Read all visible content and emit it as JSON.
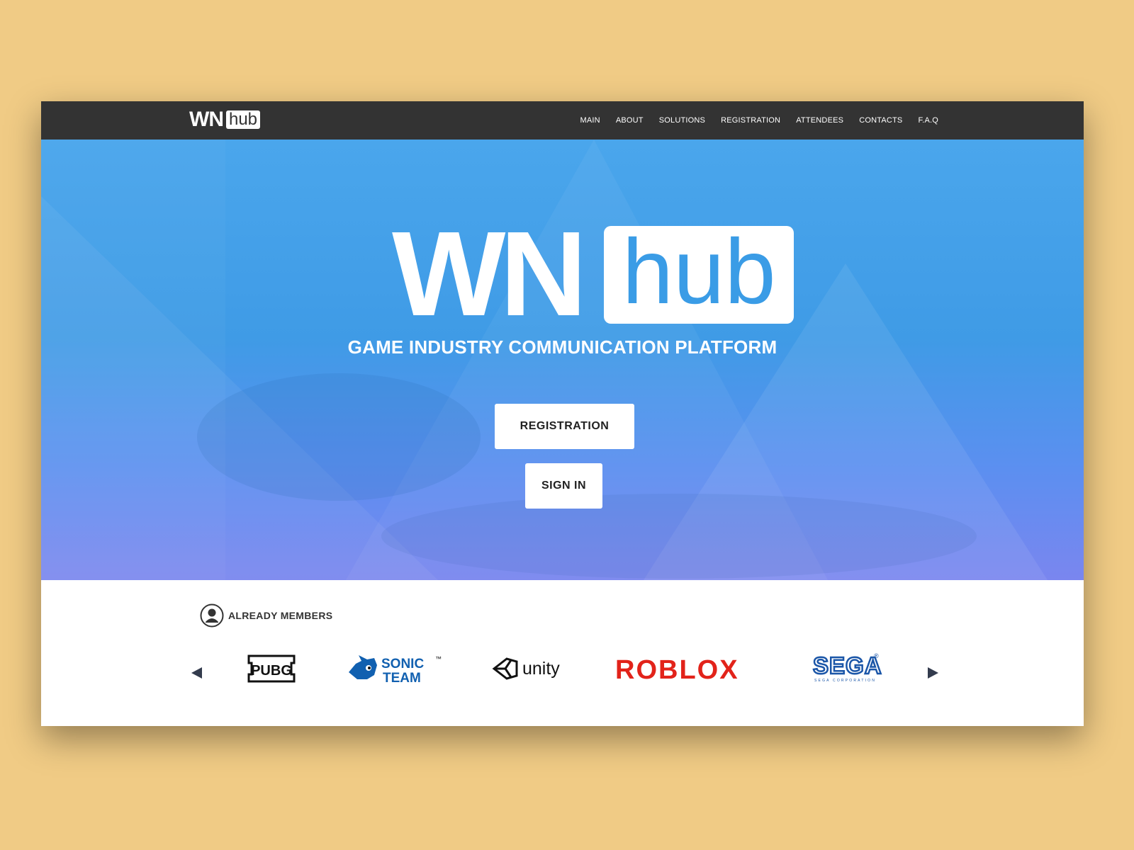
{
  "header": {
    "logo": {
      "wn": "WN",
      "hub": "hub"
    },
    "nav": [
      "MAIN",
      "ABOUT",
      "SOLUTIONS",
      "REGISTRATION",
      "ATTENDEES",
      "CONTACTS",
      "F.A.Q"
    ]
  },
  "hero": {
    "logo": {
      "wn": "WN",
      "hub": "hub"
    },
    "tagline": "GAME INDUSTRY COMMUNICATION PLATFORM",
    "registration_button": "REGISTRATION",
    "signin_button": "SIGN IN"
  },
  "members": {
    "title": "ALREADY MEMBERS",
    "brands": {
      "pubg": "PUBG",
      "sonic_top": "SONIC",
      "sonic_bottom": "TEAM",
      "sonic_tm": "™",
      "unity": "unity",
      "roblox": "ROBLOX",
      "sega": "SEGA",
      "sega_sub": "SEGA CORPORATION",
      "sega_reg": "®"
    }
  },
  "colors": {
    "page_background": "#f0cb85",
    "topbar": "#333333",
    "hero_blue": "#3f9be6",
    "hero_violet": "#7a86ef",
    "roblox_red": "#e2231a",
    "sega_blue": "#1b56a8",
    "sonic_blue": "#1160b0"
  },
  "icons": [
    "user-circle-icon",
    "arrow-left-icon",
    "arrow-right-icon"
  ]
}
